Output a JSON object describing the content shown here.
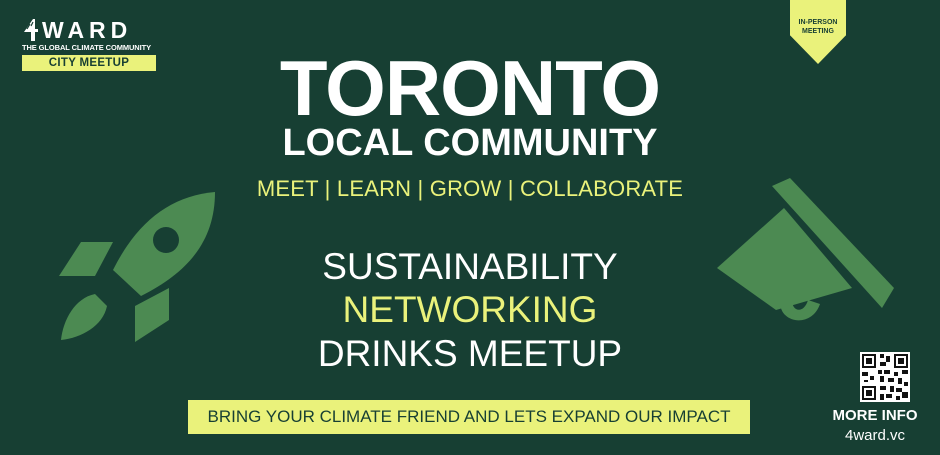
{
  "logo": {
    "name": "WARD",
    "tagline": "THE GLOBAL CLIMATE COMMUNITY",
    "badge": "CITY MEETUP"
  },
  "ribbon": {
    "line1": "IN-PERSON",
    "line2": "MEETING"
  },
  "headline": {
    "title": "TORONTO",
    "subtitle": "LOCAL COMMUNITY",
    "pillars": "MEET | LEARN | GROW | COLLABORATE"
  },
  "event": {
    "line1": "SUSTAINABILITY",
    "line2": "NETWORKING",
    "line3": "DRINKS MEETUP"
  },
  "cta": "BRING YOUR CLIMATE FRIEND AND LETS EXPAND OUR IMPACT",
  "info": {
    "label": "MORE INFO",
    "site": "4ward.vc"
  },
  "icons": {
    "left": "rocket-icon",
    "right": "megaphone-icon",
    "qr": "qr-code-icon"
  },
  "colors": {
    "background": "#173f33",
    "accent": "#eaf27b",
    "icon_green": "#4c8a52",
    "text": "#ffffff"
  }
}
